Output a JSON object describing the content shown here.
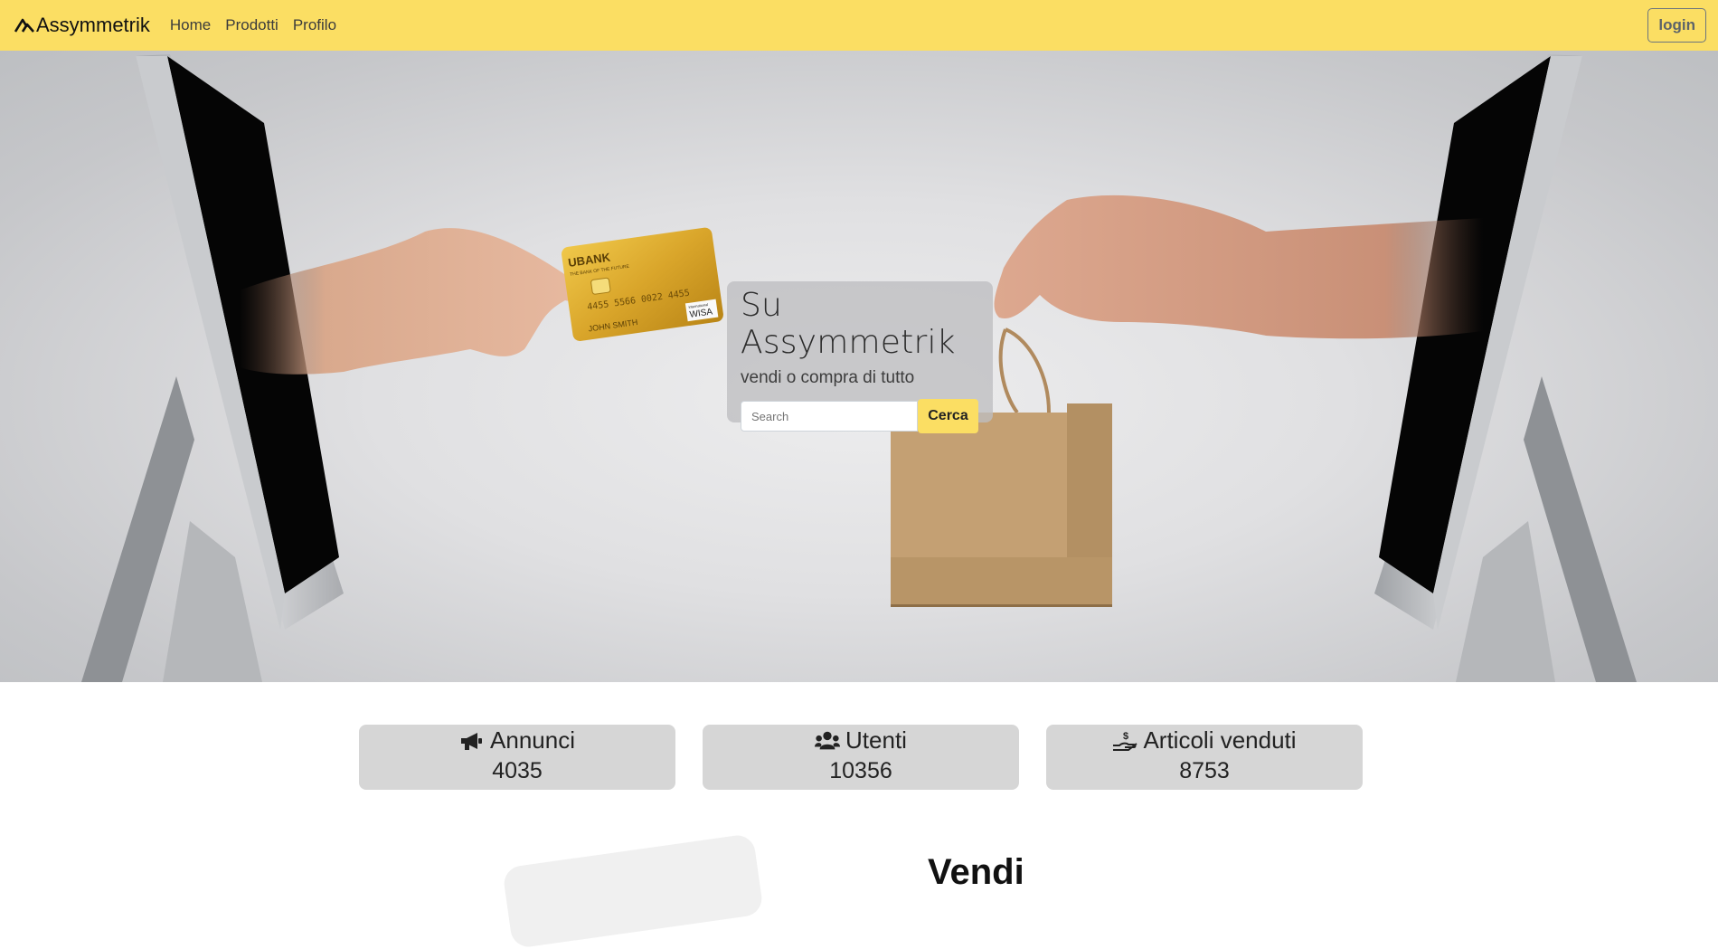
{
  "navbar": {
    "brand": "Assymmetrik",
    "links": [
      "Home",
      "Prodotti",
      "Profilo"
    ],
    "login_label": "login"
  },
  "hero": {
    "title": "Su Assymmetrik",
    "subtitle": "vendi o compra di tutto",
    "search_placeholder": "Search",
    "search_button": "Cerca",
    "card_text": {
      "bank": "UBANK",
      "tagline": "THE BANK OF THE FUTURE",
      "number": "4455 5566 0022 4455",
      "holder": "JOHN SMITH",
      "network": "WISA",
      "network_small": "international"
    }
  },
  "stats": [
    {
      "icon": "megaphone-icon",
      "label": "Annunci",
      "value": "4035"
    },
    {
      "icon": "users-icon",
      "label": "Utenti",
      "value": "10356"
    },
    {
      "icon": "hand-dollar-icon",
      "label": "Articoli venduti",
      "value": "8753"
    }
  ],
  "section": {
    "title": "Vendi"
  },
  "colors": {
    "accent": "#fbde63",
    "stat_bg": "#d6d6d6"
  }
}
